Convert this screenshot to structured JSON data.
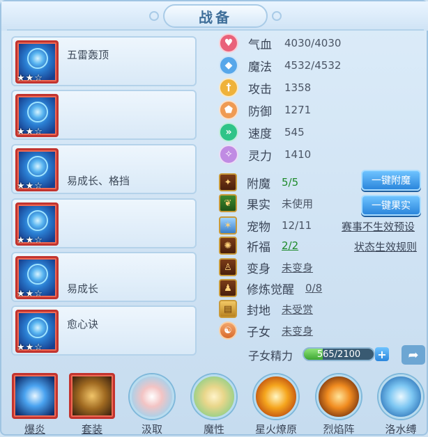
{
  "title": "战备",
  "equipment": [
    {
      "label": "五雷轰顶",
      "stars": "★★☆"
    },
    {
      "label": "",
      "stars": "★★☆"
    },
    {
      "label": "易成长、格挡",
      "stars": "★★☆"
    },
    {
      "label": "",
      "stars": "★★☆"
    },
    {
      "label": "易成长",
      "stars": "★★☆"
    },
    {
      "label": "愈心诀",
      "stars": "★★☆"
    }
  ],
  "attributes": [
    {
      "name": "气血",
      "value": "4030/4030",
      "icon": "heart-icon",
      "color": "#e9627a"
    },
    {
      "name": "魔法",
      "value": "4532/4532",
      "icon": "mana-icon",
      "color": "#57a7ea"
    },
    {
      "name": "攻击",
      "value": "1358",
      "icon": "sword-icon",
      "color": "#efb23a"
    },
    {
      "name": "防御",
      "value": "1271",
      "icon": "shield-icon",
      "color": "#ef9b53"
    },
    {
      "name": "速度",
      "value": "545",
      "icon": "speed-icon",
      "color": "#2fc488"
    },
    {
      "name": "灵力",
      "value": "1410",
      "icon": "spirit-icon",
      "color": "#c08be3"
    }
  ],
  "details": [
    {
      "name": "附魔",
      "value": "5/5",
      "icon": "enchant-icon",
      "green": true,
      "underline": false
    },
    {
      "name": "果实",
      "value": "未使用",
      "icon": "fruit-icon",
      "green": false,
      "underline": false
    },
    {
      "name": "宠物",
      "value": "12/11",
      "icon": "pet-icon",
      "green": false,
      "underline": false
    },
    {
      "name": "祈福",
      "value": "2/2",
      "icon": "blessing-icon",
      "green": true,
      "underline": true
    },
    {
      "name": "变身",
      "value": "未变身",
      "icon": "transform-icon",
      "green": false,
      "underline": true
    },
    {
      "name": "修炼觉醒",
      "value": "0/8",
      "icon": "cultivation-icon",
      "green": false,
      "underline": true
    },
    {
      "name": "封地",
      "value": "未受赏",
      "icon": "fief-icon",
      "green": false,
      "underline": true
    },
    {
      "name": "子女",
      "value": "未变身",
      "icon": "child-icon",
      "green": false,
      "underline": true
    }
  ],
  "buttons": {
    "enchant": "一键附魔",
    "fruit": "一键果实"
  },
  "links": {
    "event_preset": "赛事不生效预设",
    "status_rules": "状态生效规则"
  },
  "energy": {
    "label": "子女精力",
    "text": "565/2100",
    "fraction": 0.269
  },
  "skills": [
    {
      "name": "爆炎",
      "icon": "blast-flame-icon",
      "shape": "square",
      "underline": true
    },
    {
      "name": "套装",
      "icon": "suit-icon",
      "shape": "square",
      "underline": true
    },
    {
      "name": "汲取",
      "icon": "absorb-icon",
      "shape": "round",
      "underline": false
    },
    {
      "name": "魔性",
      "icon": "demonic-icon",
      "shape": "round",
      "underline": false
    },
    {
      "name": "星火燎原",
      "icon": "starfire-icon",
      "shape": "round",
      "underline": false
    },
    {
      "name": "烈焰阵",
      "icon": "flame-formation-icon",
      "shape": "round",
      "underline": false
    },
    {
      "name": "洛水缚",
      "icon": "luoshui-bind-icon",
      "shape": "round",
      "underline": false
    }
  ],
  "colors": {
    "accent": "#2b86dc",
    "green_value": "#1e8a2b",
    "equip_border": "#c2342f"
  }
}
